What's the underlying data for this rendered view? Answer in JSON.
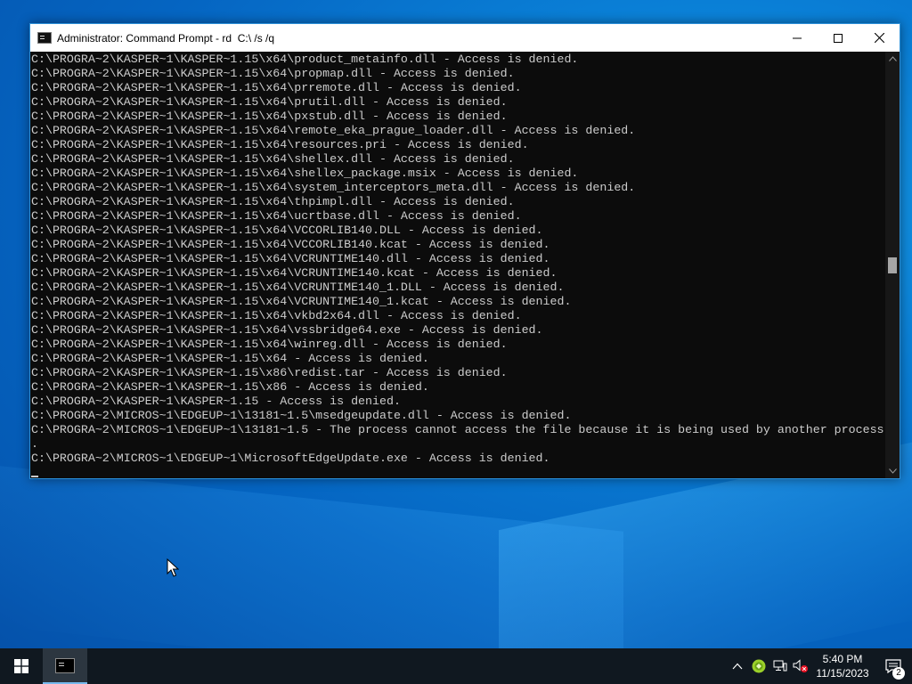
{
  "window": {
    "title": "Administrator: Command Prompt - rd  C:\\ /s /q",
    "icon": "cmd-icon",
    "controls": [
      "minimize-icon",
      "maximize-icon",
      "close-icon"
    ]
  },
  "console": {
    "lines": [
      "C:\\PROGRA~2\\KASPER~1\\KASPER~1.15\\x64\\product_metainfo.dll - Access is denied.",
      "C:\\PROGRA~2\\KASPER~1\\KASPER~1.15\\x64\\propmap.dll - Access is denied.",
      "C:\\PROGRA~2\\KASPER~1\\KASPER~1.15\\x64\\prremote.dll - Access is denied.",
      "C:\\PROGRA~2\\KASPER~1\\KASPER~1.15\\x64\\prutil.dll - Access is denied.",
      "C:\\PROGRA~2\\KASPER~1\\KASPER~1.15\\x64\\pxstub.dll - Access is denied.",
      "C:\\PROGRA~2\\KASPER~1\\KASPER~1.15\\x64\\remote_eka_prague_loader.dll - Access is denied.",
      "C:\\PROGRA~2\\KASPER~1\\KASPER~1.15\\x64\\resources.pri - Access is denied.",
      "C:\\PROGRA~2\\KASPER~1\\KASPER~1.15\\x64\\shellex.dll - Access is denied.",
      "C:\\PROGRA~2\\KASPER~1\\KASPER~1.15\\x64\\shellex_package.msix - Access is denied.",
      "C:\\PROGRA~2\\KASPER~1\\KASPER~1.15\\x64\\system_interceptors_meta.dll - Access is denied.",
      "C:\\PROGRA~2\\KASPER~1\\KASPER~1.15\\x64\\thpimpl.dll - Access is denied.",
      "C:\\PROGRA~2\\KASPER~1\\KASPER~1.15\\x64\\ucrtbase.dll - Access is denied.",
      "C:\\PROGRA~2\\KASPER~1\\KASPER~1.15\\x64\\VCCORLIB140.DLL - Access is denied.",
      "C:\\PROGRA~2\\KASPER~1\\KASPER~1.15\\x64\\VCCORLIB140.kcat - Access is denied.",
      "C:\\PROGRA~2\\KASPER~1\\KASPER~1.15\\x64\\VCRUNTIME140.dll - Access is denied.",
      "C:\\PROGRA~2\\KASPER~1\\KASPER~1.15\\x64\\VCRUNTIME140.kcat - Access is denied.",
      "C:\\PROGRA~2\\KASPER~1\\KASPER~1.15\\x64\\VCRUNTIME140_1.DLL - Access is denied.",
      "C:\\PROGRA~2\\KASPER~1\\KASPER~1.15\\x64\\VCRUNTIME140_1.kcat - Access is denied.",
      "C:\\PROGRA~2\\KASPER~1\\KASPER~1.15\\x64\\vkbd2x64.dll - Access is denied.",
      "C:\\PROGRA~2\\KASPER~1\\KASPER~1.15\\x64\\vssbridge64.exe - Access is denied.",
      "C:\\PROGRA~2\\KASPER~1\\KASPER~1.15\\x64\\winreg.dll - Access is denied.",
      "C:\\PROGRA~2\\KASPER~1\\KASPER~1.15\\x64 - Access is denied.",
      "C:\\PROGRA~2\\KASPER~1\\KASPER~1.15\\x86\\redist.tar - Access is denied.",
      "C:\\PROGRA~2\\KASPER~1\\KASPER~1.15\\x86 - Access is denied.",
      "C:\\PROGRA~2\\KASPER~1\\KASPER~1.15 - Access is denied.",
      "C:\\PROGRA~2\\MICROS~1\\EDGEUP~1\\13181~1.5\\msedgeupdate.dll - Access is denied.",
      "C:\\PROGRA~2\\MICROS~1\\EDGEUP~1\\13181~1.5 - The process cannot access the file because it is being used by another process",
      ".",
      "C:\\PROGRA~2\\MICROS~1\\EDGEUP~1\\MicrosoftEdgeUpdate.exe - Access is denied.",
      ""
    ],
    "scroll_position": 0.5
  },
  "taskbar": {
    "start_icon": "windows-logo-icon",
    "pinned": [
      {
        "name": "command-prompt",
        "icon": "cmd-icon",
        "active": true
      }
    ],
    "tray_icons": [
      "chevron-up-icon",
      "security-shield-icon",
      "network-icon",
      "volume-muted-icon"
    ],
    "clock": {
      "time": "5:40 PM",
      "date": "11/15/2023"
    },
    "notifications": {
      "icon": "action-center-icon",
      "count": "2"
    }
  },
  "colors": {
    "console_bg": "#0c0c0c",
    "console_fg": "#cccccc",
    "taskbar_bg": "#101820",
    "accent": "#76b9ed"
  }
}
